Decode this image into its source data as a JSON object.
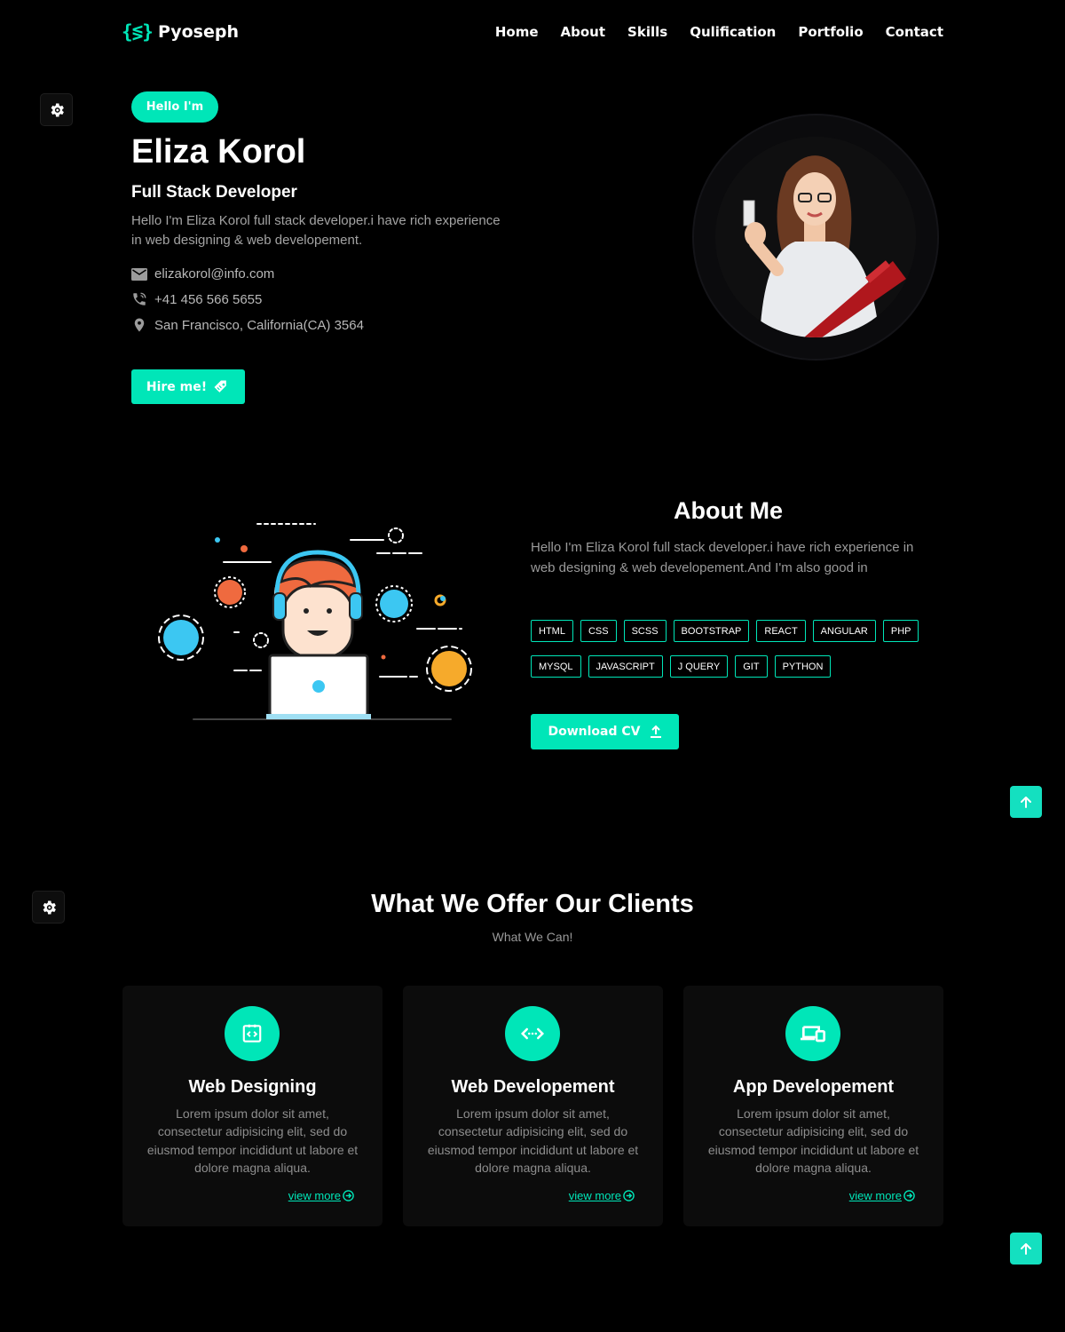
{
  "brand": {
    "mark": "{≶}",
    "name": "Pyoseph"
  },
  "nav": [
    "Home",
    "About",
    "Skills",
    "Qulification",
    "Portfolio",
    "Contact"
  ],
  "hero": {
    "greeting": "Hello I'm",
    "name": "Eliza Korol",
    "role": "Full Stack Developer",
    "description": "Hello I'm Eliza Korol full stack developer.i have rich experience in web designing & web developement.",
    "email": "elizakorol@info.com",
    "phone": "+41 456 566 5655",
    "address": "San Francisco, California(CA) 3564",
    "hire_label": "Hire me!"
  },
  "about": {
    "title": "About Me",
    "description": "Hello I'm Eliza Korol full stack developer.i have rich experience in web designing & web developement.And I'm also good in",
    "skills": [
      "HTML",
      "CSS",
      "SCSS",
      "BOOTSTRAP",
      "REACT",
      "ANGULAR",
      "PHP",
      "MYSQL",
      "JAVASCRIPT",
      "J QUERY",
      "GIT",
      "PYTHON"
    ],
    "cv_label": "Download CV"
  },
  "services": {
    "title": "What We Offer Our Clients",
    "subtitle": "What We Can!",
    "cards": [
      {
        "title": "Web Designing",
        "text": "Lorem ipsum dolor sit amet, consectetur adipisicing elit, sed do eiusmod tempor incididunt ut labore et dolore magna aliqua.",
        "link": "view more",
        "icon": "code-frame-icon"
      },
      {
        "title": "Web Developement",
        "text": "Lorem ipsum dolor sit amet, consectetur adipisicing elit, sed do eiusmod tempor incididunt ut labore et dolore magna aliqua.",
        "link": "view more",
        "icon": "code-arrows-icon"
      },
      {
        "title": "App Developement",
        "text": "Lorem ipsum dolor sit amet, consectetur adipisicing elit, sed do eiusmod tempor incididunt ut labore et dolore magna aliqua.",
        "link": "view more",
        "icon": "devices-icon"
      }
    ]
  },
  "colors": {
    "accent": "#00e6b8",
    "background": "#000000",
    "card": "#0c0c0c"
  }
}
